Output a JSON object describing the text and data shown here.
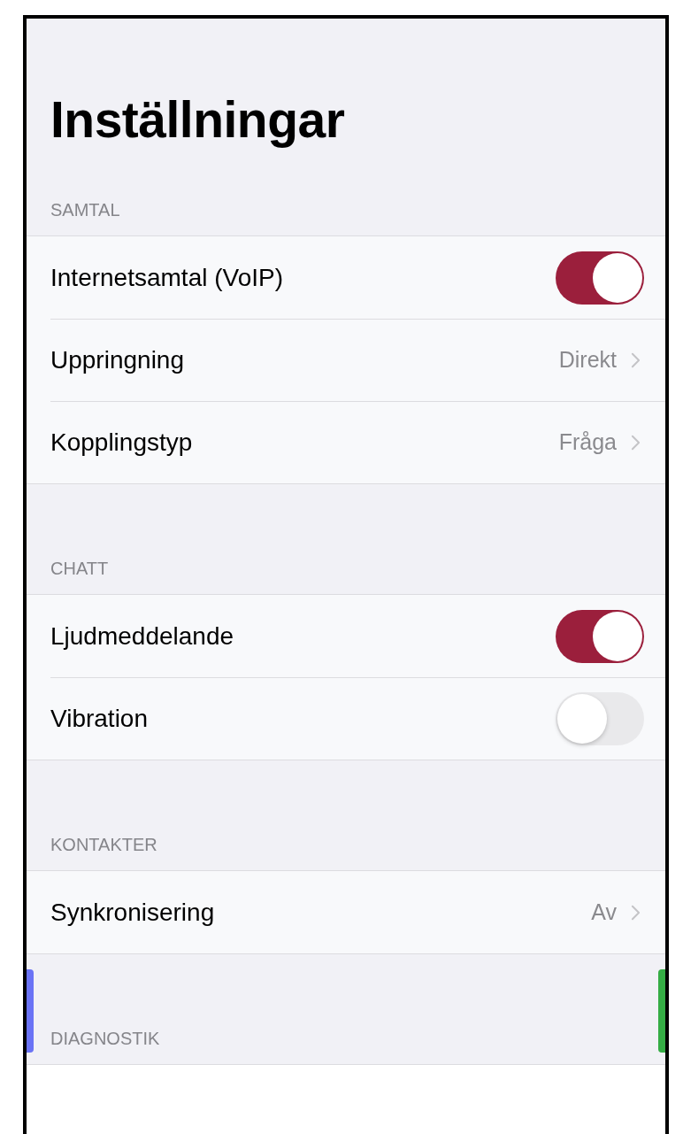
{
  "title": "Inställningar",
  "sections": [
    {
      "header": "SAMTAL",
      "rows": [
        {
          "kind": "toggle",
          "label": "Internetsamtal (VoIP)",
          "on": true
        },
        {
          "kind": "link",
          "label": "Uppringning",
          "value": "Direkt"
        },
        {
          "kind": "link",
          "label": "Kopplingstyp",
          "value": "Fråga"
        }
      ]
    },
    {
      "header": "CHATT",
      "rows": [
        {
          "kind": "toggle",
          "label": "Ljudmeddelande",
          "on": true
        },
        {
          "kind": "toggle",
          "label": "Vibration",
          "on": false
        }
      ]
    },
    {
      "header": "KONTAKTER",
      "rows": [
        {
          "kind": "link",
          "label": "Synkronisering",
          "value": "Av"
        }
      ]
    },
    {
      "header": "DIAGNOSTIK"
    }
  ]
}
